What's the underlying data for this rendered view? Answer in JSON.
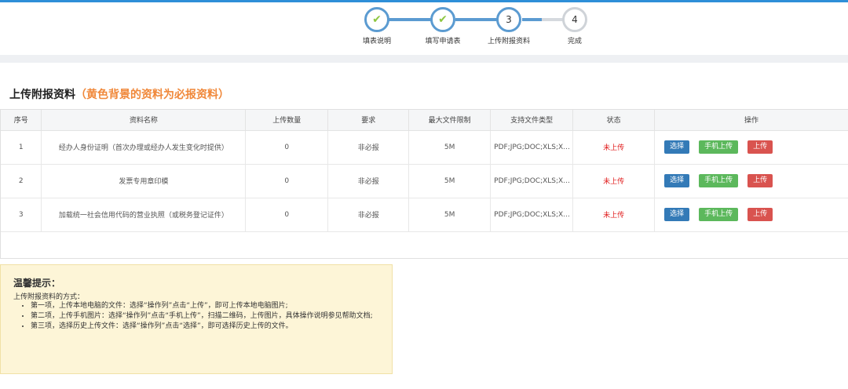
{
  "stepper": {
    "steps": [
      {
        "label": "填表说明",
        "state": "done",
        "mark": "✔"
      },
      {
        "label": "填写申请表",
        "state": "done",
        "mark": "✔"
      },
      {
        "label": "上传附报资料",
        "state": "active",
        "mark": "3"
      },
      {
        "label": "完成",
        "state": "todo",
        "mark": "4"
      }
    ]
  },
  "title": {
    "main": "上传附报资料",
    "note": "（黄色背景的资料为必报资料）"
  },
  "table": {
    "headers": [
      "序号",
      "资料名称",
      "上传数量",
      "要求",
      "最大文件限制",
      "支持文件类型",
      "状态",
      "操作"
    ],
    "rows": [
      {
        "index": "1",
        "name": "经办人身份证明（首次办理或经办人发生变化时提供）",
        "count": "0",
        "req": "非必报",
        "max": "5M",
        "types": "PDF;JPG;DOC;XLS;X...",
        "status": "未上传"
      },
      {
        "index": "2",
        "name": "发票专用章印模",
        "count": "0",
        "req": "非必报",
        "max": "5M",
        "types": "PDF;JPG;DOC;XLS;X...",
        "status": "未上传"
      },
      {
        "index": "3",
        "name": "加载统一社会信用代码的营业执照（或税务登记证件）",
        "count": "0",
        "req": "非必报",
        "max": "5M",
        "types": "PDF;JPG;DOC;XLS;X...",
        "status": "未上传"
      }
    ],
    "actions": {
      "select": "选择",
      "mobile": "手机上传",
      "upload": "上传"
    }
  },
  "tips": {
    "title": "温馨提示：",
    "intro": "上传附报资料的方式：",
    "items": [
      "第一项，上传本地电脑的文件：选择“操作列”点击“上传”，即可上传本地电脑图片;",
      "第二项，上传手机图片：选择“操作列”点击“手机上传”，扫描二维码，上传图片，具体操作说明参见帮助文档;",
      "第三项，选择历史上传文件：选择“操作列”点击“选择”，即可选择历史上传的文件。"
    ]
  },
  "colors": {
    "accent": "#2e8fd8",
    "step_done": "#5b9bd1",
    "check": "#8dc63f",
    "title_note": "#f0883a",
    "status": "#e01b1b",
    "tips_bg": "#fdf5d7"
  }
}
